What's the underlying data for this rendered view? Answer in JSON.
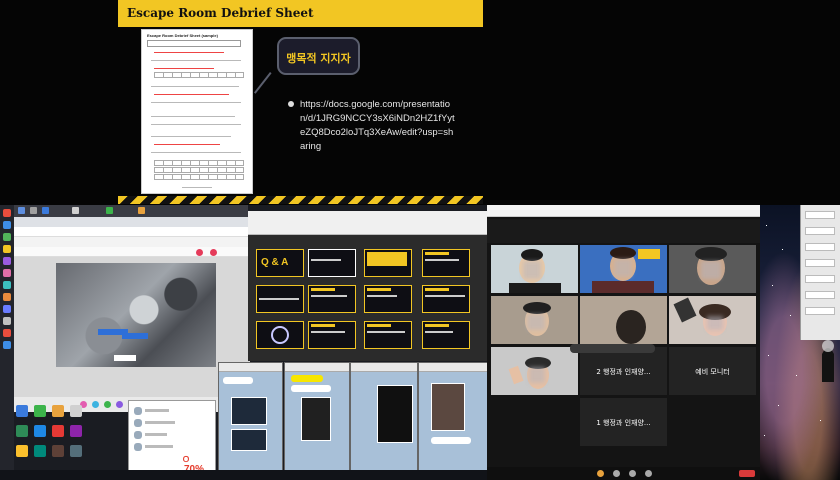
{
  "slide": {
    "title": "Escape Room Debrief Sheet",
    "sheet_title": "Escape Room Debrief Sheet (sample)",
    "bubble_text": "맹목적 지지자",
    "url": "https://docs.google.com/presentation/d/1JRG9NCCY3sX6iNDn2HZ1fYyteZQ8Dco2loJTq3XeAw/edit?usp=sharing",
    "colors": {
      "accent": "#f2c623",
      "background": "#050505"
    }
  },
  "sorter": {
    "qa_label": "Q & A"
  },
  "friend_list": {
    "promo_text": "70%"
  },
  "zoom": {
    "tiles": [
      {
        "name": "2 행정과 인재양..."
      },
      {
        "name": "예비 모니터"
      },
      {
        "name": "1 행정과 인재양..."
      }
    ]
  },
  "icons": [
    "grid-icon",
    "chat-icon",
    "folder-icon",
    "browser-icon",
    "mic-icon",
    "video-icon"
  ]
}
